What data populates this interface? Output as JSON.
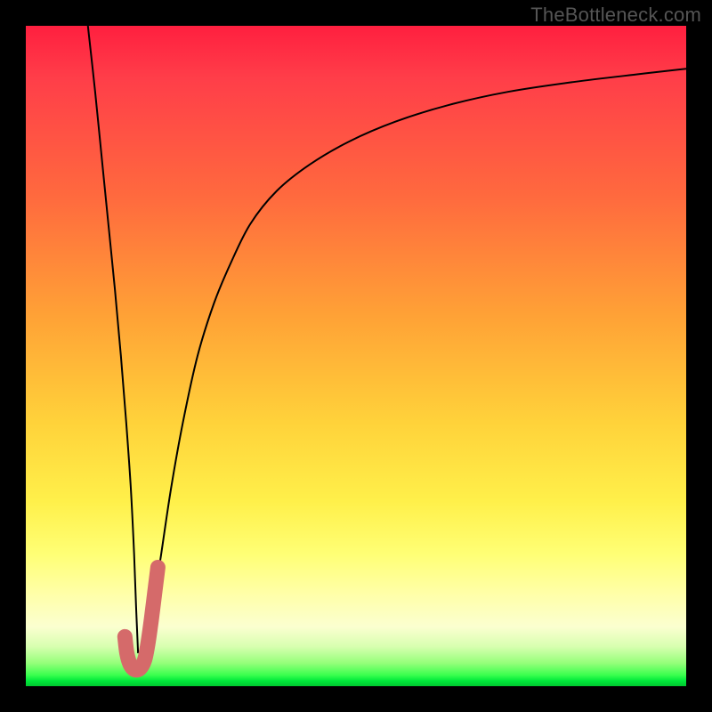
{
  "watermark": {
    "text": "TheBottleneck.com"
  },
  "chart_data": {
    "type": "line",
    "title": "",
    "xlabel": "",
    "ylabel": "",
    "xlim": [
      0,
      100
    ],
    "ylim": [
      0,
      100
    ],
    "grid": false,
    "legend": false,
    "background": "heatmap-gradient-vertical",
    "series": [
      {
        "name": "left-branch",
        "stroke": "#000000",
        "stroke_width": 2,
        "x": [
          9.4,
          10.5,
          11.5,
          12.5,
          13.5,
          14.4,
          15.2,
          15.9,
          16.4,
          16.7,
          17.0
        ],
        "values": [
          100,
          90,
          80,
          70,
          60,
          50,
          40,
          30,
          20,
          12,
          5
        ]
      },
      {
        "name": "right-branch",
        "stroke": "#000000",
        "stroke_width": 2,
        "x": [
          18.5,
          19.3,
          20.5,
          22.0,
          23.8,
          26.0,
          28.5,
          31.0,
          34.0,
          38.0,
          43.0,
          49.0,
          56.0,
          64.0,
          73.0,
          83.0,
          93.0,
          100.0
        ],
        "values": [
          5,
          12,
          20,
          30,
          40,
          50,
          58,
          64,
          70,
          75,
          79,
          82.5,
          85.5,
          88,
          90,
          91.5,
          92.7,
          93.5
        ]
      },
      {
        "name": "hook-marker",
        "stroke": "#d56a6a",
        "stroke_width": 17,
        "linecap": "round",
        "x": [
          15.0,
          15.3,
          15.8,
          16.5,
          17.3,
          18.0,
          18.5,
          19.0,
          19.5,
          20.0
        ],
        "values": [
          7.5,
          5.0,
          3.3,
          2.5,
          2.7,
          4.0,
          6.5,
          10.0,
          14.0,
          18.0
        ]
      }
    ]
  }
}
